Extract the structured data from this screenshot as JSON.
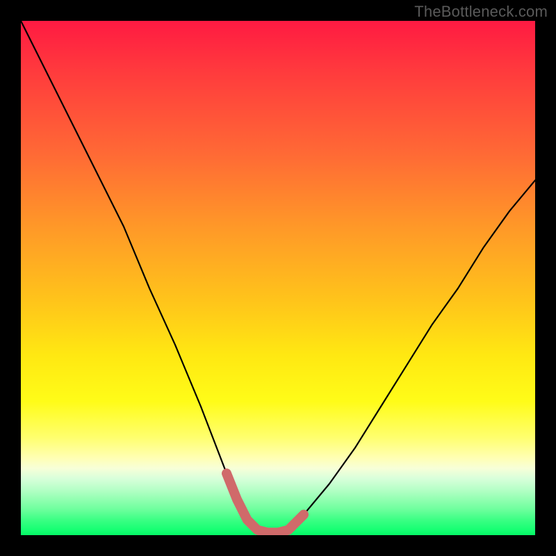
{
  "watermark": "TheBottleneck.com",
  "chart_data": {
    "type": "line",
    "title": "",
    "xlabel": "",
    "ylabel": "",
    "xlim": [
      0,
      100
    ],
    "ylim": [
      0,
      100
    ],
    "series": [
      {
        "name": "bottleneck-curve",
        "x": [
          0,
          5,
          10,
          15,
          20,
          25,
          30,
          35,
          40,
          42,
          44,
          46,
          48,
          50,
          52,
          55,
          60,
          65,
          70,
          75,
          80,
          85,
          90,
          95,
          100
        ],
        "values": [
          100,
          90,
          80,
          70,
          60,
          48,
          37,
          25,
          12,
          7,
          3,
          1,
          0.5,
          0.5,
          1,
          4,
          10,
          17,
          25,
          33,
          41,
          48,
          56,
          63,
          69
        ]
      },
      {
        "name": "highlight-segment",
        "x": [
          40,
          42,
          44,
          46,
          48,
          50,
          52,
          55
        ],
        "values": [
          12,
          7,
          3,
          1,
          0.5,
          0.5,
          1,
          4
        ]
      }
    ],
    "colors": {
      "curve": "#000000",
      "highlight": "#d06a6a"
    }
  }
}
